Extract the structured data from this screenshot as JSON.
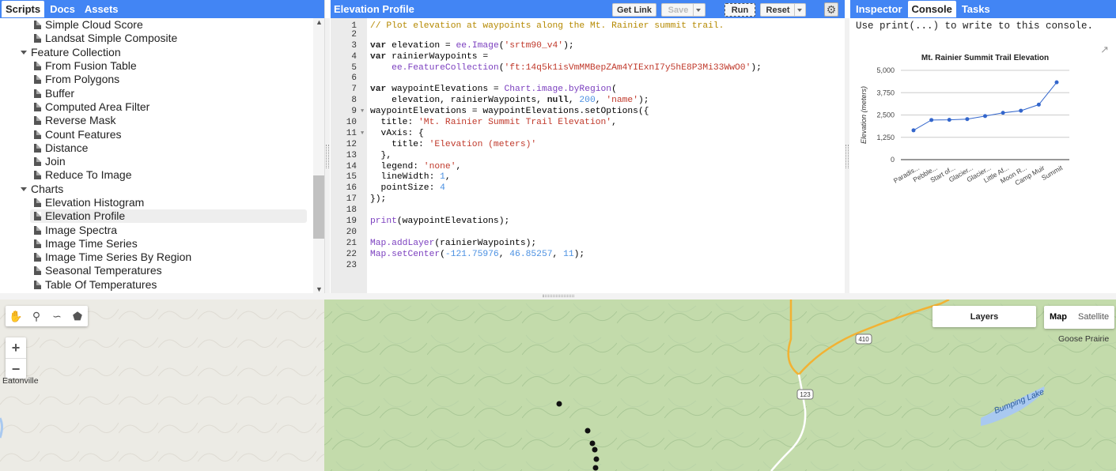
{
  "left_panel": {
    "tabs": [
      "Scripts",
      "Docs",
      "Assets"
    ],
    "active_tab": "Scripts",
    "tree": [
      {
        "label": "Simple Cloud Score",
        "type": "file",
        "depth": 1
      },
      {
        "label": "Landsat Simple Composite",
        "type": "file",
        "depth": 1
      },
      {
        "label": "Feature Collection",
        "type": "folder",
        "depth": 0
      },
      {
        "label": "From Fusion Table",
        "type": "file",
        "depth": 1
      },
      {
        "label": "From Polygons",
        "type": "file",
        "depth": 1
      },
      {
        "label": "Buffer",
        "type": "file",
        "depth": 1
      },
      {
        "label": "Computed Area Filter",
        "type": "file",
        "depth": 1
      },
      {
        "label": "Reverse Mask",
        "type": "file",
        "depth": 1
      },
      {
        "label": "Count Features",
        "type": "file",
        "depth": 1
      },
      {
        "label": "Distance",
        "type": "file",
        "depth": 1
      },
      {
        "label": "Join",
        "type": "file",
        "depth": 1
      },
      {
        "label": "Reduce To Image",
        "type": "file",
        "depth": 1
      },
      {
        "label": "Charts",
        "type": "folder",
        "depth": 0
      },
      {
        "label": "Elevation Histogram",
        "type": "file",
        "depth": 1
      },
      {
        "label": "Elevation Profile",
        "type": "file",
        "depth": 1,
        "selected": true
      },
      {
        "label": "Image Spectra",
        "type": "file",
        "depth": 1
      },
      {
        "label": "Image Time Series",
        "type": "file",
        "depth": 1
      },
      {
        "label": "Image Time Series By Region",
        "type": "file",
        "depth": 1
      },
      {
        "label": "Seasonal Temperatures",
        "type": "file",
        "depth": 1
      },
      {
        "label": "Table Of Temperatures",
        "type": "file",
        "depth": 1
      }
    ]
  },
  "editor": {
    "title": "Elevation Profile",
    "buttons": {
      "get_link": "Get Link",
      "save": "Save",
      "run": "Run",
      "reset": "Reset"
    },
    "lines": [
      "// Plot elevation at waypoints along the Mt. Rainier summit trail.",
      "",
      "var elevation = ee.Image('srtm90_v4');",
      "var rainierWaypoints =",
      "    ee.FeatureCollection('ft:14q5k1isVmMMBepZAm4YIExnI7y5hE8P3Mi33WwO0');",
      "",
      "var waypointElevations = Chart.image.byRegion(",
      "    elevation, rainierWaypoints, null, 200, 'name');",
      "waypointElevations = waypointElevations.setOptions({",
      "  title: 'Mt. Rainier Summit Trail Elevation',",
      "  vAxis: {",
      "    title: 'Elevation (meters)'",
      "  },",
      "  legend: 'none',",
      "  lineWidth: 1,",
      "  pointSize: 4",
      "});",
      "",
      "print(waypointElevations);",
      "",
      "Map.addLayer(rainierWaypoints);",
      "Map.setCenter(-121.75976, 46.85257, 11);",
      ""
    ]
  },
  "right_panel": {
    "tabs": [
      "Inspector",
      "Console",
      "Tasks"
    ],
    "active_tab": "Console",
    "hint": "Use print(...) to write to this console."
  },
  "chart_data": {
    "type": "line",
    "title": "Mt. Rainier Summit Trail Elevation",
    "ylabel": "Elevation (meters)",
    "xlabel": "",
    "categories": [
      "Paradis...",
      "Pebble...",
      "Start of...",
      "Glacier...",
      "Glacier...",
      "Little Af...",
      "Moon R...",
      "Camp Muir",
      "Summit"
    ],
    "values": [
      1640,
      2220,
      2230,
      2270,
      2440,
      2620,
      2740,
      3080,
      4330
    ],
    "ylim": [
      0,
      5000
    ],
    "yticks": [
      "5,000",
      "3,750",
      "2,500",
      "1,250",
      "0"
    ],
    "ytick_values": [
      5000,
      3750,
      2500,
      1250,
      0
    ],
    "color": "#3366cc",
    "legend": "none",
    "grid": true
  },
  "map": {
    "layers_label": "Layers",
    "map_type_options": [
      "Map",
      "Satellite"
    ],
    "map_type_selected": "Map",
    "place_labels": [
      "Eatonville",
      "Goose Prairie",
      "Bumping Lake"
    ],
    "road_shields": [
      "410",
      "123"
    ]
  }
}
